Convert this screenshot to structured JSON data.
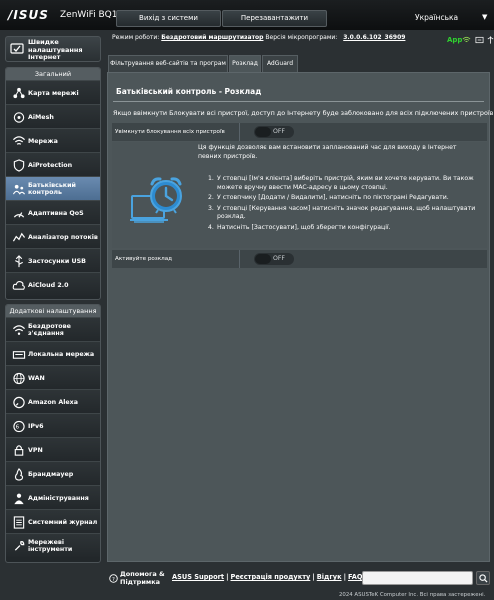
{
  "header": {
    "logo": "/ISUS",
    "model": "ZenWiFi BQ16",
    "logout_label": "Вихід з системи",
    "reboot_label": "Перезавантажити",
    "language": "Українська"
  },
  "status": {
    "mode_prefix": "Режим роботи:",
    "mode_value": "Бездротовий маршрутизатор",
    "firmware_prefix": "Версія мікропрограми:",
    "firmware_value": "3.0.0.6.102_36909",
    "app_label": "App"
  },
  "sidebar": {
    "qis_label": "Швидке налаштування Інтернет",
    "general_header": "Загальний",
    "general_items": [
      {
        "label": "Карта мережі",
        "icon": "network-map-icon"
      },
      {
        "label": "AiMesh",
        "icon": "aimesh-icon"
      },
      {
        "label": "Мережа",
        "icon": "network-icon"
      },
      {
        "label": "AiProtection",
        "icon": "shield-icon"
      },
      {
        "label": "Батьківський контроль",
        "icon": "parental-control-icon"
      },
      {
        "label": "Адаптивна QoS",
        "icon": "qos-icon"
      },
      {
        "label": "Аналізатор потоків",
        "icon": "traffic-analyzer-icon"
      },
      {
        "label": "Застосунки USB",
        "icon": "usb-icon"
      },
      {
        "label": "AiCloud 2.0",
        "icon": "cloud-icon"
      }
    ],
    "advanced_header": "Додаткові налаштування",
    "advanced_items": [
      {
        "label": "Бездротове з'єднання",
        "icon": "wireless-icon"
      },
      {
        "label": "Локальна мережа",
        "icon": "lan-icon"
      },
      {
        "label": "WAN",
        "icon": "globe-icon"
      },
      {
        "label": "Amazon Alexa",
        "icon": "alexa-icon"
      },
      {
        "label": "IPv6",
        "icon": "ipv6-icon"
      },
      {
        "label": "VPN",
        "icon": "vpn-icon"
      },
      {
        "label": "Брандмауер",
        "icon": "firewall-icon"
      },
      {
        "label": "Адміністрування",
        "icon": "administration-icon"
      },
      {
        "label": "Системний журнал",
        "icon": "system-log-icon"
      },
      {
        "label": "Мережеві інструменти",
        "icon": "network-tools-icon"
      }
    ]
  },
  "tabs": [
    "Фільтрування веб-сайтів та програм",
    "Розклад",
    "AdGuard"
  ],
  "main": {
    "title": "Батьківський контроль - Розклад",
    "description": "Якщо ввімкнути Блокувати всі пристрої, доступ до Інтернету буде заблоковано для всіх підключених пристроїв.",
    "block_all_label": "Увімкнути блокування всіх пристроїв",
    "block_all_state": "OFF",
    "intro": "Ця функція дозволяє вам встановити запланований час для виходу в Інтернет певних пристроїв.",
    "steps": [
      {
        "n": "1.",
        "text": "У стовпці [Ім'я клієнта] виберіть пристрій, яким ви хочете керувати. Ви також можете вручну ввести MAC-адресу в цьому стовпці."
      },
      {
        "n": "2.",
        "text": "У стовпчику [Додати / Видалити], натисніть по піктограмі Редагувати."
      },
      {
        "n": "3.",
        "text": "У стовпці [Керування часом] натисніть значок редагування, щоб налаштувати розклад."
      },
      {
        "n": "4.",
        "text": "Натисніть [Застосувати], щоб зберегти конфігурації."
      }
    ],
    "schedule_label": "Активуйте розклад",
    "schedule_state": "OFF"
  },
  "footer": {
    "help_label": "Допомога & Підтримка",
    "links": [
      "ASUS Support",
      "Реєстрація продукту",
      "Відгук",
      "FAQ"
    ],
    "copyright": "2024 ASUSTeK Computer Inc. Всі права застережені."
  }
}
